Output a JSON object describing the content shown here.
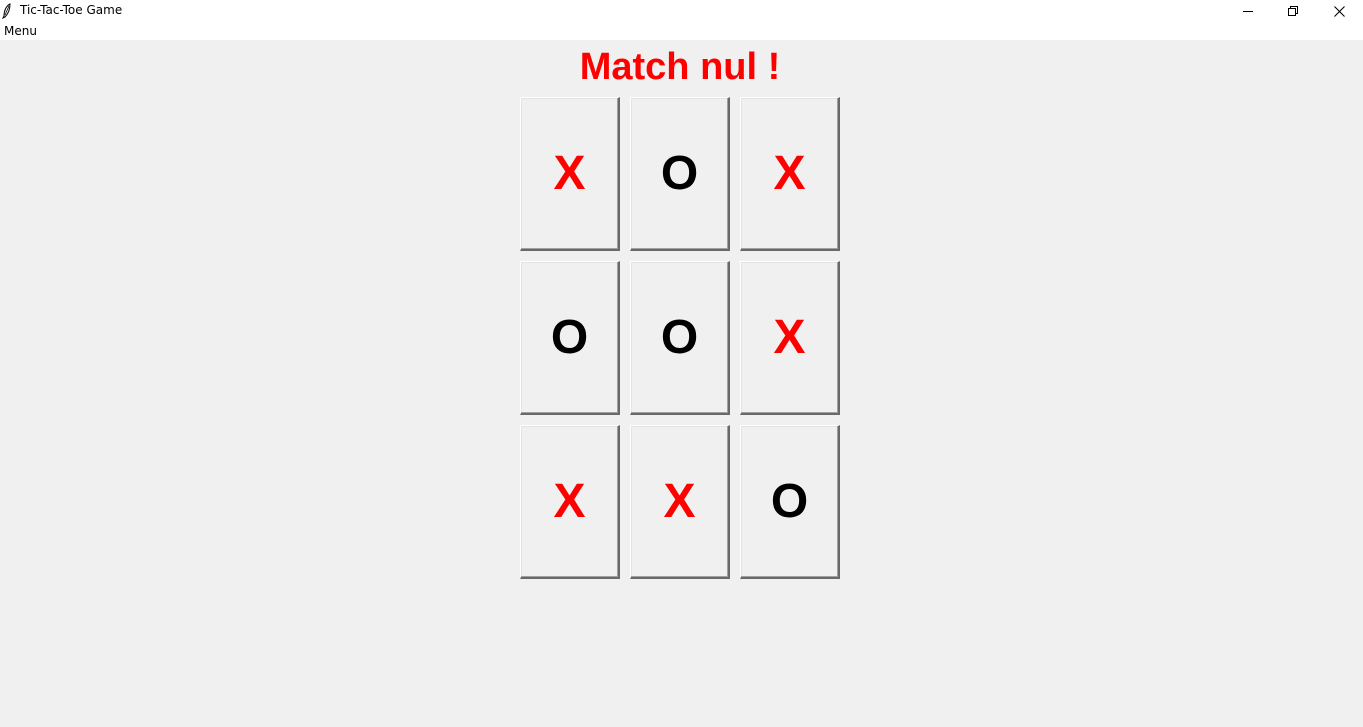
{
  "window": {
    "title": "Tic-Tac-Toe Game",
    "app_icon": "feather-icon"
  },
  "menubar": {
    "items": [
      "Menu"
    ]
  },
  "status": {
    "text": "Match nul !",
    "color": "#ff0000"
  },
  "board": {
    "cells": [
      [
        "X",
        "O",
        "X"
      ],
      [
        "O",
        "O",
        "X"
      ],
      [
        "X",
        "X",
        "O"
      ]
    ],
    "colors": {
      "X": "#ff0000",
      "O": "#000000"
    }
  }
}
